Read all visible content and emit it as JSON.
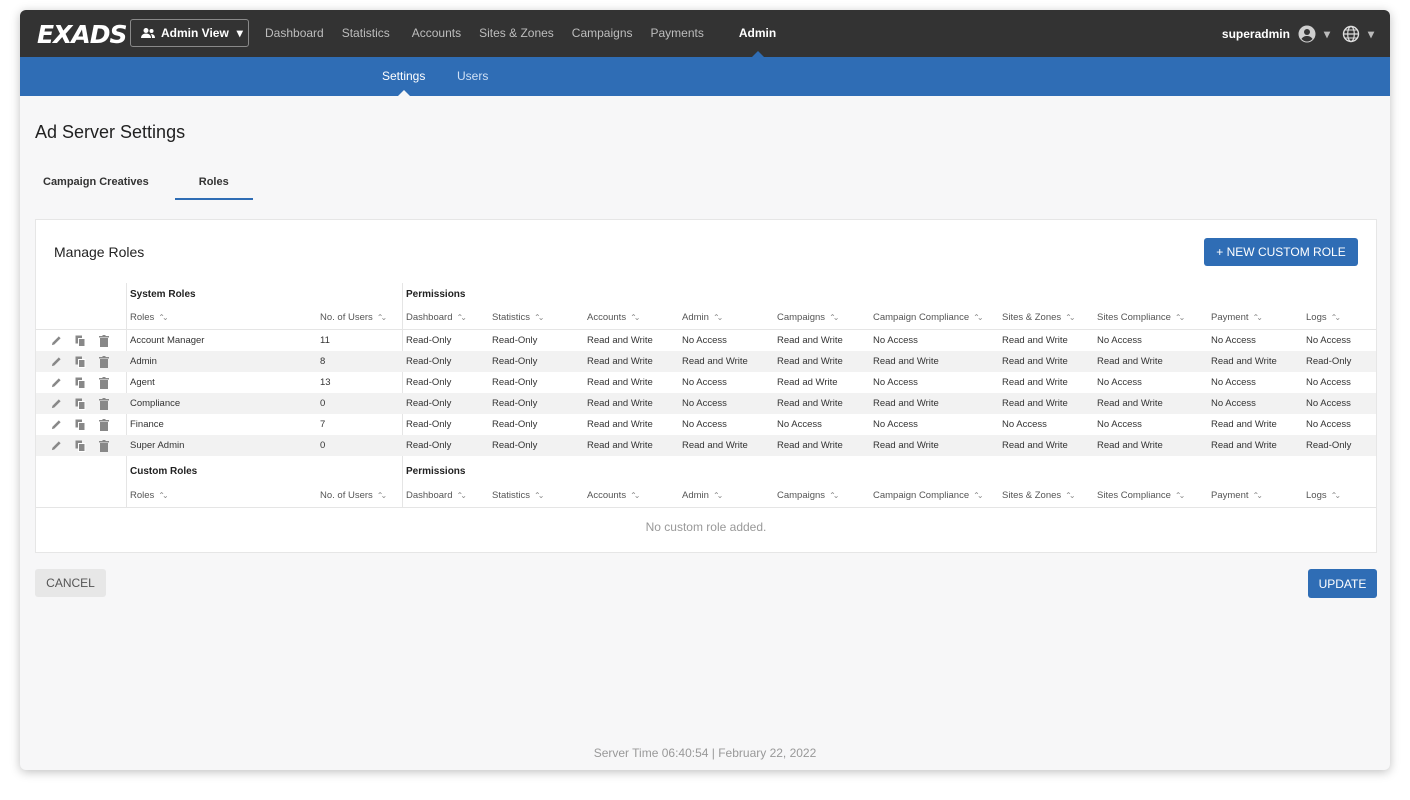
{
  "app": {
    "logo": "EXADS",
    "view_selector": "Admin View"
  },
  "nav": {
    "items": [
      "Dashboard",
      "Statistics",
      "Accounts",
      "Sites & Zones",
      "Campaigns",
      "Payments"
    ],
    "active": "Admin"
  },
  "user": {
    "name": "superadmin"
  },
  "subnav": {
    "settings": "Settings",
    "users": "Users"
  },
  "page": {
    "title": "Ad Server Settings"
  },
  "tabs": {
    "campaign_creatives": "Campaign Creatives",
    "roles": "Roles"
  },
  "card": {
    "title": "Manage Roles",
    "new_button": "+ NEW CUSTOM ROLE"
  },
  "table": {
    "system_roles_label": "System Roles",
    "custom_roles_label": "Custom Roles",
    "permissions_label": "Permissions",
    "columns": [
      "Roles",
      "No. of Users",
      "Dashboard",
      "Statistics",
      "Accounts",
      "Admin",
      "Campaigns",
      "Campaign Compliance",
      "Sites & Zones",
      "Sites Compliance",
      "Payment",
      "Logs"
    ],
    "rows": [
      [
        "Account Manager",
        "11",
        "Read-Only",
        "Read-Only",
        "Read and Write",
        "No Access",
        "Read and Write",
        "No Access",
        "Read and Write",
        "No Access",
        "No Access",
        "No Access"
      ],
      [
        "Admin",
        "8",
        "Read-Only",
        "Read-Only",
        "Read and Write",
        "Read and Write",
        "Read and Write",
        "Read and Write",
        "Read and Write",
        "Read and Write",
        "Read and Write",
        "Read-Only"
      ],
      [
        "Agent",
        "13",
        "Read-Only",
        "Read-Only",
        "Read and Write",
        "No Access",
        "Read ad Write",
        "No Access",
        "Read and Write",
        "No Access",
        "No Access",
        "No Access"
      ],
      [
        "Compliance",
        "0",
        "Read-Only",
        "Read-Only",
        "Read and Write",
        "No Access",
        "Read and Write",
        "Read and Write",
        "Read and Write",
        "Read and Write",
        "No Access",
        "No Access"
      ],
      [
        "Finance",
        "7",
        "Read-Only",
        "Read-Only",
        "Read and Write",
        "No Access",
        "No Access",
        "No Access",
        "No Access",
        "No Access",
        "Read and Write",
        "No Access"
      ],
      [
        "Super Admin",
        "0",
        "Read-Only",
        "Read-Only",
        "Read and Write",
        "Read and Write",
        "Read and Write",
        "Read and Write",
        "Read and Write",
        "Read and Write",
        "Read and Write",
        "Read-Only"
      ]
    ],
    "empty_message": "No custom role added."
  },
  "actions": {
    "cancel": "CANCEL",
    "update": "UPDATE"
  },
  "footer": {
    "server_time": "Server Time 06:40:54 | February 22, 2022"
  },
  "colors": {
    "topbar": "#333333",
    "accent": "#2f6db5"
  }
}
